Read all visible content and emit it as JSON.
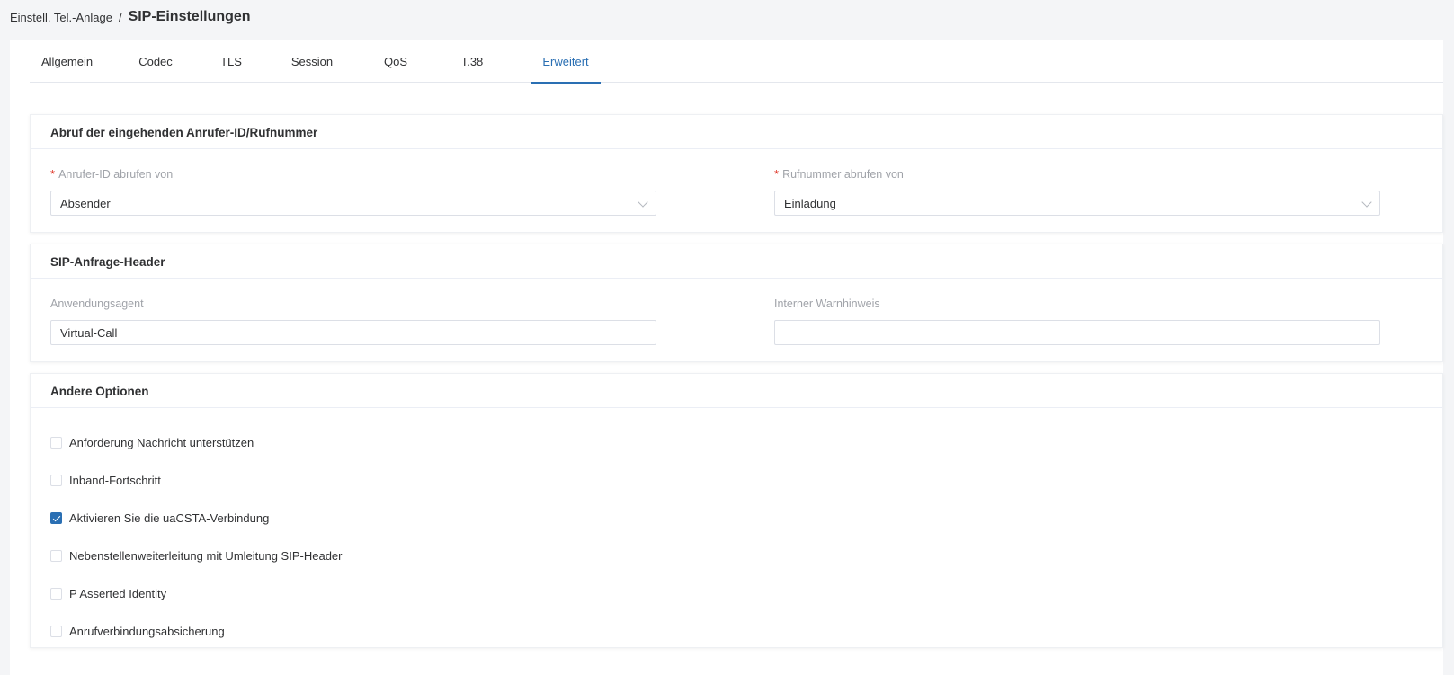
{
  "breadcrumb": {
    "parent": "Einstell. Tel.-Anlage",
    "separator": "/",
    "current": "SIP-Einstellungen"
  },
  "tabs": [
    {
      "label": "Allgemein",
      "active": false
    },
    {
      "label": "Codec",
      "active": false
    },
    {
      "label": "TLS",
      "active": false
    },
    {
      "label": "Session",
      "active": false
    },
    {
      "label": "QoS",
      "active": false
    },
    {
      "label": "T.38",
      "active": false
    },
    {
      "label": "Erweitert",
      "active": true
    }
  ],
  "caller_section": {
    "title": "Abruf der eingehenden Anrufer-ID/Rufnummer",
    "caller_id": {
      "label": "Anrufer-ID abrufen von",
      "required": "*",
      "value": "Absender"
    },
    "number": {
      "label": "Rufnummer abrufen von",
      "required": "*",
      "value": "Einladung"
    }
  },
  "header_section": {
    "title": "SIP-Anfrage-Header",
    "user_agent": {
      "label": "Anwendungsagent",
      "value": "Virtual-Call"
    },
    "internal_warning": {
      "label": "Interner Warnhinweis",
      "value": ""
    }
  },
  "options_section": {
    "title": "Andere Optionen",
    "options": [
      {
        "label": "Anforderung Nachricht unterstützen",
        "checked": false
      },
      {
        "label": "Inband-Fortschritt",
        "checked": false
      },
      {
        "label": "Aktivieren Sie die uaCSTA-Verbindung",
        "checked": true
      },
      {
        "label": "Nebenstellenweiterleitung mit Umleitung SIP-Header",
        "checked": false
      },
      {
        "label": "P Asserted Identity",
        "checked": false
      },
      {
        "label": "Anrufverbindungsabsicherung",
        "checked": false
      }
    ]
  },
  "colors": {
    "accent": "#2a6fb3",
    "required": "#e0392b",
    "background": "#f4f5f7"
  }
}
